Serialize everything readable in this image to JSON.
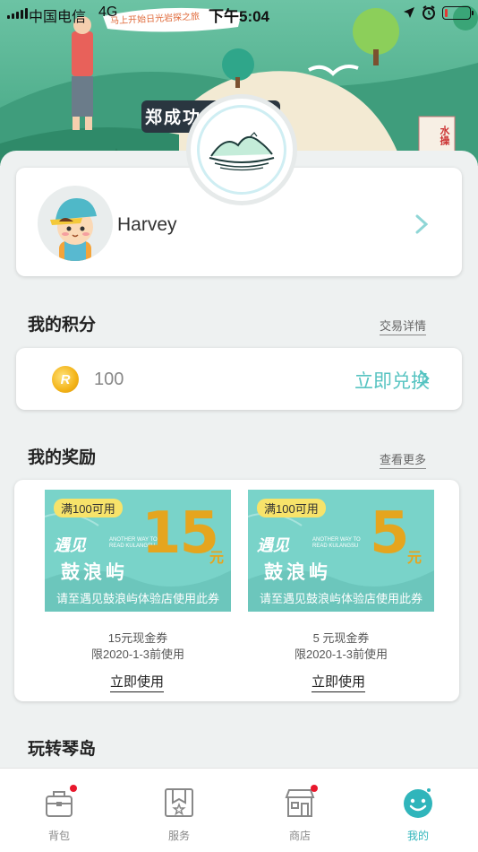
{
  "status_bar": {
    "carrier": "中国电信",
    "network": "4G",
    "time": "下午5:04",
    "battery_level": 0.12
  },
  "header": {
    "banner_sign": "郑成功",
    "speech_bubble": "马上开始日光岩探之旅",
    "signpost": "水操"
  },
  "profile": {
    "username": "Harvey"
  },
  "points": {
    "section_title": "我的积分",
    "details_link": "交易详情",
    "value": "100",
    "redeem_label": "立即兑换"
  },
  "rewards": {
    "section_title": "我的奖励",
    "more_link": "查看更多",
    "coupons": [
      {
        "requirement": "满100可用",
        "amount": "15",
        "unit": "元",
        "brand_line1": "遇见",
        "brand_line2": "鼓浪屿",
        "brand_en": "ANOTHER WAY TO READ KULANGSU",
        "note": "请至遇见鼓浪屿体验店使用此券",
        "name": "15元现金券",
        "expiry": "限2020-1-3前使用",
        "use_label": "立即使用"
      },
      {
        "requirement": "满100可用",
        "amount": "5",
        "unit": "元",
        "brand_line1": "遇见",
        "brand_line2": "鼓浪屿",
        "brand_en": "ANOTHER WAY TO READ KULANGSU",
        "note": "请至遇见鼓浪屿体验店使用此券",
        "name": "5 元现金券",
        "expiry": "限2020-1-3前使用",
        "use_label": "立即使用"
      }
    ]
  },
  "play": {
    "section_title": "玩转琴岛"
  },
  "tabbar": {
    "items": [
      {
        "label": "背包",
        "icon": "backpack-icon",
        "badge": true
      },
      {
        "label": "服务",
        "icon": "bookmark-star-icon",
        "badge": false
      },
      {
        "label": "商店",
        "icon": "store-icon",
        "badge": true
      },
      {
        "label": "我的",
        "icon": "smiley-icon",
        "badge": false,
        "active": true
      }
    ]
  },
  "colors": {
    "accent": "#30b5bb",
    "redeem": "#58c4c2",
    "coupon_bg": "#79d3c9",
    "coupon_amount": "#e5a51e",
    "badge_red": "#e8172c"
  }
}
